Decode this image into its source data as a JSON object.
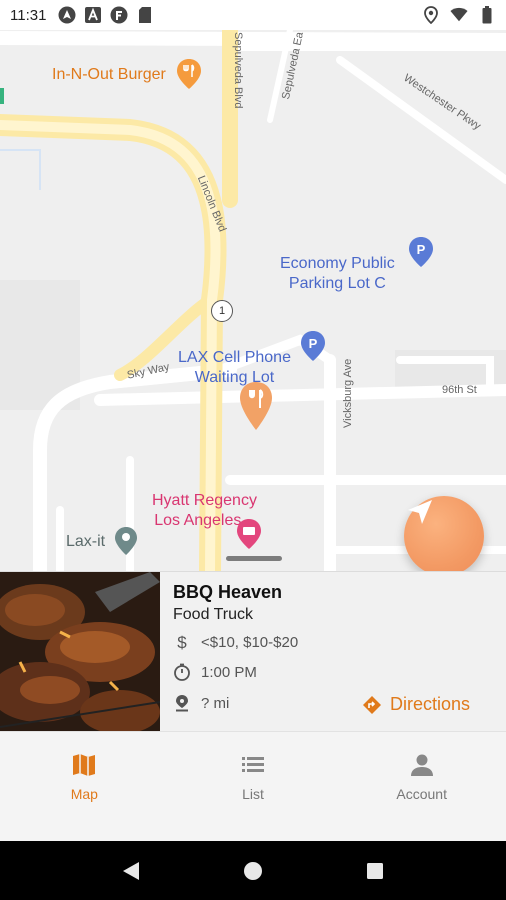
{
  "status_bar": {
    "time": "11:31",
    "left_icons": [
      "android-auto-icon",
      "font-a-icon",
      "notification-f-icon",
      "sd-card-icon"
    ],
    "right_icons": [
      "location-icon",
      "wifi-icon",
      "battery-icon"
    ]
  },
  "map": {
    "places": {
      "in_n_out": "In-N-Out Burger",
      "economy_parking": "Economy Public\nParking Lot C",
      "lax_cell_phone": "LAX Cell Phone\nWaiting Lot",
      "hyatt": "Hyatt Regency\nLos Angeles...",
      "lax_it": "Lax-it"
    },
    "streets": {
      "sepulveda_blvd": "Sepulveda Blvd",
      "sepulveda_east": "Sepulveda Ea",
      "westchester_pkwy": "Westchester Pkwy",
      "lincoln_blvd": "Lincoln Blvd",
      "sky_way": "Sky Way",
      "ninety_sixth": "96th St",
      "vicksburg_ave": "Vicksburg Ave",
      "route_shield": "1"
    },
    "accent_color": "#e07a1b"
  },
  "card": {
    "title": "BBQ Heaven",
    "category": "Food Truck",
    "price": "<$10, $10-$20",
    "hours": "1:00 PM",
    "distance": "? mi",
    "directions_label": "Directions"
  },
  "bottom_nav": {
    "items": [
      {
        "label": "Map",
        "icon": "map-icon",
        "active": true
      },
      {
        "label": "List",
        "icon": "list-icon",
        "active": false
      },
      {
        "label": "Account",
        "icon": "account-icon",
        "active": false
      }
    ]
  },
  "system_nav": [
    "back-icon",
    "home-icon",
    "recents-icon"
  ]
}
